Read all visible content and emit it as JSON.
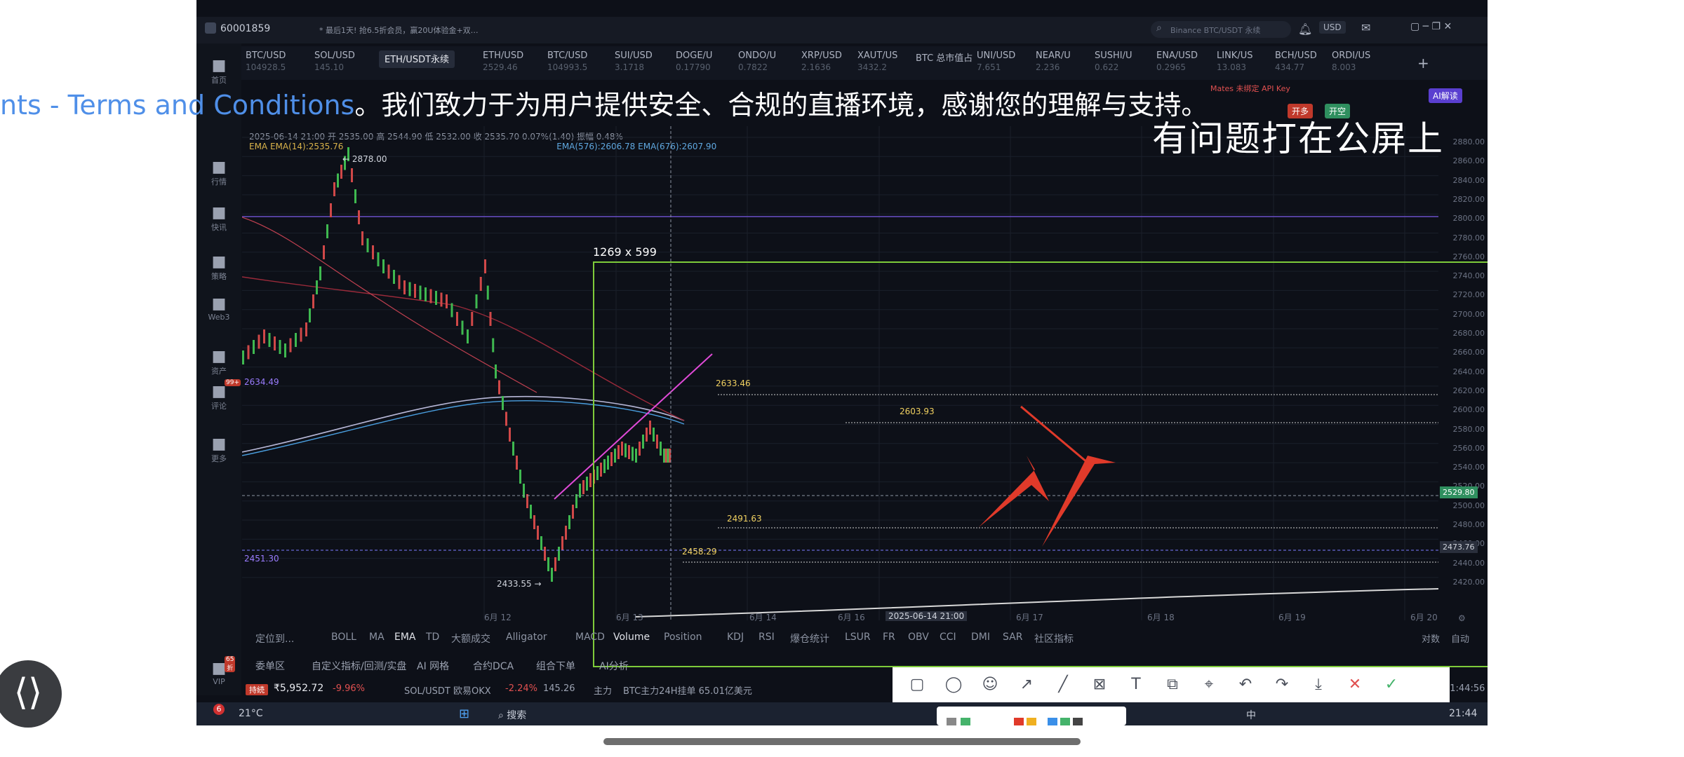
{
  "window": {
    "account_id": "60001859",
    "promo_text": "* 最后1天! 抢6.5折会员，赢20U体验金+双…",
    "search_placeholder": "Binance BTC/USDT 永续",
    "currency": "USD"
  },
  "tabs": [
    {
      "label": "BTC/USD",
      "sub": "104928.5",
      "active": false
    },
    {
      "label": "SOL/USD",
      "sub": "145.10",
      "active": false
    },
    {
      "label": "ETH/USDT永续",
      "sub": "",
      "active": true
    },
    {
      "label": "ETH/USD",
      "sub": "2529.46",
      "active": false
    },
    {
      "label": "BTC/USD",
      "sub": "104993.5",
      "active": false
    },
    {
      "label": "SUI/USD",
      "sub": "3.1718",
      "active": false
    },
    {
      "label": "DOGE/U",
      "sub": "0.17790",
      "active": false
    },
    {
      "label": "ONDO/U",
      "sub": "0.7822",
      "active": false
    },
    {
      "label": "XRP/USD",
      "sub": "2.1636",
      "active": false
    },
    {
      "label": "XAUT/US",
      "sub": "3432.2",
      "active": false
    },
    {
      "label": "BTC 总市值占",
      "sub": "",
      "active": false
    },
    {
      "label": "UNI/USD",
      "sub": "7.651",
      "active": false
    },
    {
      "label": "NEAR/U",
      "sub": "2.236",
      "active": false
    },
    {
      "label": "SUSHI/U",
      "sub": "0.622",
      "active": false
    },
    {
      "label": "ENA/USD",
      "sub": "0.2965",
      "active": false
    },
    {
      "label": "LINK/US",
      "sub": "13.083",
      "active": false
    },
    {
      "label": "BCH/USD",
      "sub": "434.77",
      "active": false
    },
    {
      "label": "ORDI/US",
      "sub": "8.003",
      "active": false
    }
  ],
  "sidebar": [
    {
      "icon": "home-icon",
      "label": "首页"
    },
    {
      "icon": "chart-icon",
      "label": "行情"
    },
    {
      "icon": "news-icon",
      "label": "快讯"
    },
    {
      "icon": "robot-icon",
      "label": "策略"
    },
    {
      "icon": "web3-icon",
      "label": "Web3"
    },
    {
      "icon": "asset-icon",
      "label": "资产"
    },
    {
      "icon": "comment-icon",
      "label": "评论",
      "badge": "99+"
    },
    {
      "icon": "more-icon",
      "label": "更多"
    },
    {
      "icon": "vip-icon",
      "label": "VIP",
      "badge": "65折"
    }
  ],
  "chart_header": {
    "ohlc": "2025-06-14 21:00  开 2535.00  高 2544.90  低 2532.00  收 2535.70  0.07%(1.40)  振幅 0.48%",
    "ema_line": "EMA  EMA(14):2535.76",
    "ema_extra": "EMA(576):2606.78  EMA(676):2607.90"
  },
  "overlay": {
    "banner_link": "nts - Terms and Conditions",
    "banner_text": "。我们致力于为用户提供安全、合规的直播环境，感谢您的理解与支持。",
    "watermark": "有问题打在公屏上",
    "selection_size": "1269 x 599"
  },
  "price_labels": {
    "high": "2878.00",
    "low": "2433.55",
    "left_upper": "2634.49",
    "left_lower": "2451.30",
    "line_2633": "2633.46",
    "line_2603": "2603.93",
    "line_2491": "2491.63",
    "line_2458": "2458.29",
    "current": "2529.80",
    "cursor": "2473.76"
  },
  "y_axis": [
    "2880.00",
    "2860.00",
    "2840.00",
    "2820.00",
    "2800.00",
    "2780.00",
    "2760.00",
    "2740.00",
    "2720.00",
    "2700.00",
    "2680.00",
    "2660.00",
    "2640.00",
    "2620.00",
    "2600.00",
    "2580.00",
    "2560.00",
    "2540.00",
    "2520.00",
    "2500.00",
    "2480.00",
    "2460.00",
    "2440.00",
    "2420.00"
  ],
  "x_axis": [
    "6月 12",
    "6月 13",
    "6月 14",
    "2025-06-14 21:00",
    "6月 16",
    "6月 17",
    "6月 18",
    "6月 19",
    "6月 20"
  ],
  "axis_controls": {
    "log": "对数",
    "auto": "自动"
  },
  "indicators": [
    "定位到...",
    "BOLL",
    "MA",
    "EMA",
    "TD",
    "大额成交",
    "Alligator",
    "MACD",
    "Volume",
    "Position",
    "KDJ",
    "RSI",
    "爆仓统计",
    "LSUR",
    "FR",
    "OBV",
    "CCI",
    "DMI",
    "SAR",
    "社区指标"
  ],
  "bottom_tabs": [
    "委单区",
    "自定义指标/回测/实盘",
    "AI 网格",
    "合约DCA",
    "组合下单",
    "AI分析"
  ],
  "ticker": {
    "badge": "持続",
    "price": "₹5,952.72",
    "change": "-9.96%",
    "pair": "SOL/USDT 欧易OKX",
    "pair_change": "-2.24%",
    "pair_price": "145.26",
    "main_label": "主力",
    "main_text": "BTC主力24H挂单 65.01亿美元",
    "time": "21:44:56"
  },
  "right_panel": {
    "label": "Mates 未绑定 API Key",
    "buy": "开多",
    "sell": "开空",
    "ai": "AI解读"
  },
  "taskbar": {
    "weather_temp": "21°C",
    "weather_badge": "6",
    "search": "搜索",
    "time": "21:44",
    "lang": "中"
  },
  "toolbar": {
    "tools": [
      "rectangle-icon",
      "circle-icon",
      "emoji-icon",
      "arrow-icon",
      "line-icon",
      "mosaic-icon",
      "text-icon",
      "copy-icon",
      "crop-icon",
      "undo-icon",
      "share-icon",
      "download-icon",
      "close-icon",
      "confirm-icon"
    ]
  },
  "colors": {
    "background": "#0d1018",
    "accent_green": "#7ecb3a",
    "arrow_red": "#e03a2a",
    "link_blue": "#4f8fe8"
  }
}
